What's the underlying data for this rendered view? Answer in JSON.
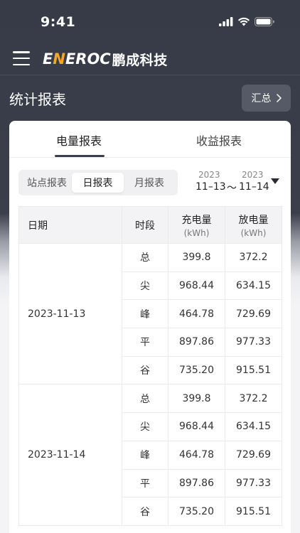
{
  "status": {
    "time": "9:41"
  },
  "nav": {
    "logo_text_a": "E",
    "logo_text_n": "N",
    "logo_text_b": "EROC",
    "logo_cn": "鹏成科技",
    "accent_color": "#f5a623"
  },
  "header": {
    "title": "统计报表",
    "summary_label": "汇总"
  },
  "tabs": [
    {
      "label": "电量报表",
      "active": true
    },
    {
      "label": "收益报表",
      "active": false
    }
  ],
  "segments": [
    {
      "label": "站点报表",
      "active": false
    },
    {
      "label": "日报表",
      "active": true
    },
    {
      "label": "月报表",
      "active": false
    }
  ],
  "date_range": {
    "start_year": "2023",
    "start_date": "11–13",
    "separator": "～",
    "end_year": "2023",
    "end_date": "11–14"
  },
  "table": {
    "headers": {
      "date": "日期",
      "period": "时段",
      "charge": "充电量",
      "discharge": "放电量",
      "unit": "(kWh)"
    },
    "groups": [
      {
        "date": "2023-11-13",
        "rows": [
          {
            "period": "总",
            "charge": "399.8",
            "discharge": "372.2"
          },
          {
            "period": "尖",
            "charge": "968.44",
            "discharge": "634.15"
          },
          {
            "period": "峰",
            "charge": "464.78",
            "discharge": "729.69"
          },
          {
            "period": "平",
            "charge": "897.86",
            "discharge": "977.33"
          },
          {
            "period": "谷",
            "charge": "735.20",
            "discharge": "915.51"
          }
        ]
      },
      {
        "date": "2023-11-14",
        "rows": [
          {
            "period": "总",
            "charge": "399.8",
            "discharge": "372.2"
          },
          {
            "period": "尖",
            "charge": "968.44",
            "discharge": "634.15"
          },
          {
            "period": "峰",
            "charge": "464.78",
            "discharge": "729.69"
          },
          {
            "period": "平",
            "charge": "897.86",
            "discharge": "977.33"
          },
          {
            "period": "谷",
            "charge": "735.20",
            "discharge": "915.51"
          }
        ]
      }
    ]
  }
}
